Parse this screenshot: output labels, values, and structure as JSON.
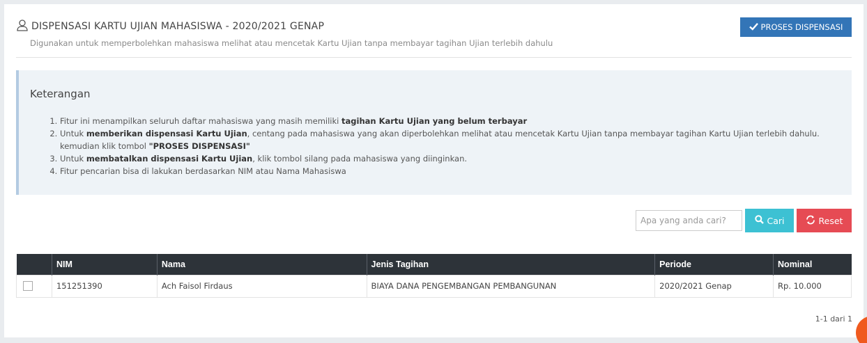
{
  "header": {
    "title": "DISPENSASI KARTU UJIAN MAHASISWA - 2020/2021 GENAP",
    "subtitle": "Digunakan untuk memperbolehkan mahasiswa melihat atau mencetak Kartu Ujian tanpa membayar tagihan Ujian terlebih dahulu",
    "proses_label": "PROSES DISPENSASI"
  },
  "info": {
    "heading": "Keterangan",
    "item1_text": "Fitur ini menampilkan seluruh daftar mahasiswa yang masih memiliki ",
    "item1_bold": "tagihan Kartu Ujian yang belum terbayar",
    "item2_text_a": "Untuk ",
    "item2_bold_a": "memberikan dispensasi Kartu Ujian",
    "item2_text_b": ", centang pada mahasiswa yang akan diperbolehkan melihat atau mencetak Kartu Ujian tanpa membayar tagihan Kartu Ujian terlebih dahulu. kemudian klik tombol ",
    "item2_bold_b": "\"PROSES DISPENSASI\"",
    "item3_text_a": "Untuk ",
    "item3_bold": "membatalkan dispensasi Kartu Ujian",
    "item3_text_b": ", klik tombol silang pada mahasiswa yang diinginkan.",
    "item4_text": "Fitur pencarian bisa di lakukan berdasarkan NIM atau Nama Mahasiswa"
  },
  "search": {
    "placeholder": "Apa yang anda cari?",
    "cari_label": "Cari",
    "reset_label": "Reset"
  },
  "table": {
    "headers": {
      "nim": "NIM",
      "nama": "Nama",
      "jenis": "Jenis Tagihan",
      "periode": "Periode",
      "nominal": "Nominal"
    },
    "rows": [
      {
        "nim": "151251390",
        "nama": "Ach Faisol Firdaus",
        "jenis": "BIAYA DANA PENGEMBANGAN PEMBANGUNAN",
        "periode": "2020/2021 Genap",
        "nominal": "Rp. 10.000"
      }
    ]
  },
  "pagination": {
    "text": "1-1 dari 1"
  },
  "colors": {
    "primary": "#3375b7",
    "info": "#3dc1d3",
    "danger": "#e64b54",
    "table_header": "#2d3339",
    "fab": "#f05a1e"
  },
  "icons": {
    "title": "user-icon",
    "proses": "check-icon",
    "cari": "search-icon",
    "reset": "refresh-icon"
  }
}
